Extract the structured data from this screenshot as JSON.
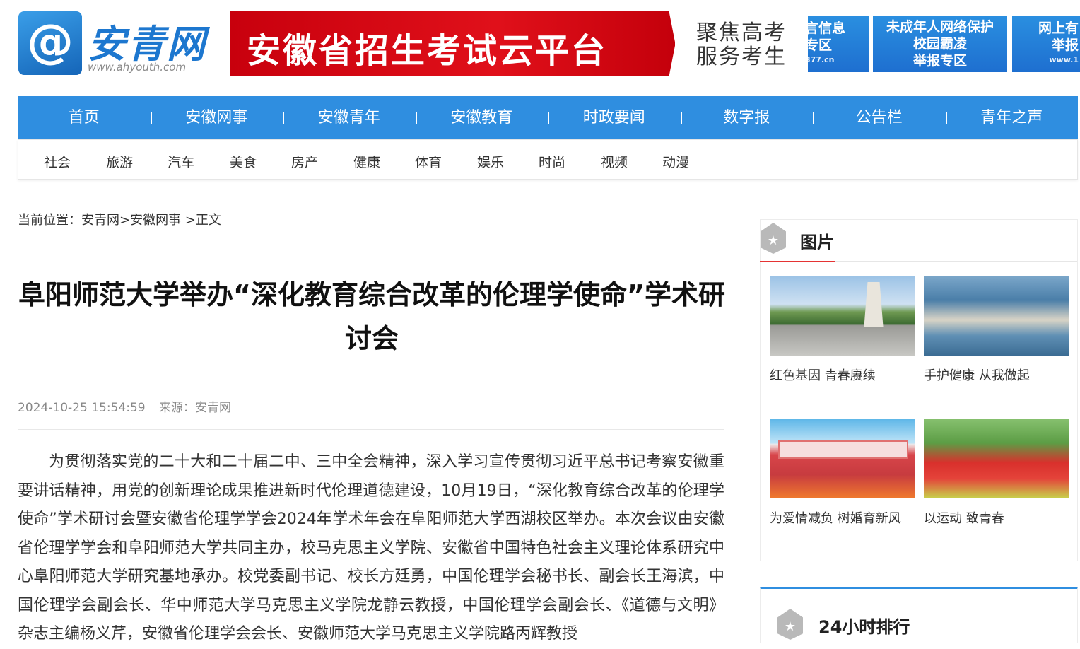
{
  "header": {
    "logo_symbol": "@",
    "logo_text": "安青网",
    "logo_url_text": "www.ahyouth.com",
    "banner_text": "安徽省招生考试云平台",
    "banner_side_line1": "聚焦高考",
    "banner_side_line2": "服务考生",
    "ad1_line1": "言信息",
    "ad1_line2": "专区",
    "ad1_small": "377.cn",
    "ad2_line1": "未成年人网络保护",
    "ad2_line2": "校园霸凌",
    "ad2_line3": "举报专区",
    "ad3_line1": "网上有",
    "ad3_line2": "举报",
    "ad3_small": "www.1"
  },
  "nav": {
    "items": [
      "首页",
      "安徽网事",
      "安徽青年",
      "安徽教育",
      "时政要闻",
      "数字报",
      "公告栏",
      "青年之声"
    ]
  },
  "subnav": {
    "items": [
      "社会",
      "旅游",
      "汽车",
      "美食",
      "房产",
      "健康",
      "体育",
      "娱乐",
      "时尚",
      "视频",
      "动漫"
    ]
  },
  "breadcrumb": {
    "prefix": "当前位置：",
    "home": "安青网",
    "sep1": ">",
    "section": "安徽网事",
    "sep2": " >",
    "current": "正文"
  },
  "article": {
    "title": "阜阳师范大学举办“深化教育综合改革的伦理学使命”学术研讨会",
    "datetime": "2024-10-25 15:54:59",
    "source": "来源：安青网",
    "body": "为贯彻落实党的二十大和二十届二中、三中全会精神，深入学习宣传贯彻习近平总书记考察安徽重要讲话精神，用党的创新理论成果推进新时代伦理道德建设，10月19日，“深化教育综合改革的伦理学使命”学术研讨会暨安徽省伦理学学会2024年学术年会在阜阳师范大学西湖校区举办。本次会议由安徽省伦理学学会和阜阳师范大学共同主办，校马克思主义学院、安徽省中国特色社会主义理论体系研究中心阜阳师范大学研究基地承办。校党委副书记、校长方廷勇，中国伦理学会秘书长、副会长王海滨，中国伦理学会副会长、华中师范大学马克思主义学院龙静云教授，中国伦理学会副会长、《道德与文明》杂志主编杨义芹，安徽省伦理学会会长、安徽师范大学马克思主义学院路丙辉教授"
  },
  "sidebar": {
    "photos_title": "图片",
    "photos": [
      {
        "caption": "红色基因 青春赓续"
      },
      {
        "caption": "手护健康 从我做起"
      },
      {
        "caption": "为爱情减负 树婚育新风"
      },
      {
        "caption": "以运动 致青春"
      }
    ],
    "ranking_title": "24小时排行"
  }
}
